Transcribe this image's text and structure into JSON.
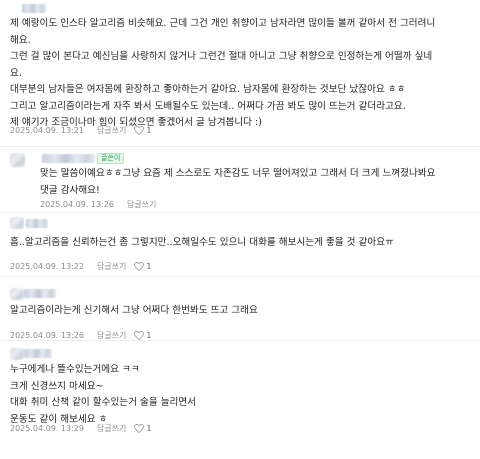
{
  "comments": [
    {
      "lines": [
        "제 예랑이도 인스타 알고리즘 비슷해요. 근데 그건 개인 취향이고 남자라면 많이들 볼꺼 같아서 전 그러려니",
        "해요.",
        "그런 걸 많이 본다고 예신님을 사랑하지 않거나 그런건 절대 아니고 그냥 취향으로 인정하는게 어떨까 싶네",
        "요.",
        "대부분의 남자들은 여자몸에 환장하고 좋아하는거 같아요. 남자몸에 환장하는 것보단 났잖아요 ㅎㅎ",
        "그리고 알고리즘이라는게 자주 봐서 도배될수도 있는데.. 어쩌다 가끔 봐도 많이 뜨는거 같더라고요.",
        "제 얘기가 조금이나마 힘이 되셨으면 좋겠어서 글 남겨봅니다 :)"
      ],
      "date": "2025.04.09. 13:21",
      "reply": "답글쓰기",
      "likes": "1"
    },
    {
      "badge": "글쓴이",
      "lines": [
        "맞는 말씀이예요ㅎㅎ그냥 요즘 제 스스로도 자존감도 너무 떨어져있고 그래서 더 크게 느껴졌나봐요",
        "댓글 감사해요!"
      ],
      "date": "2025.04.09. 13:26",
      "reply": "답글쓰기"
    },
    {
      "lines": [
        "흠..알고리즘을 신뢰하는건 좀 그렇지만..오해일수도 있으니 대화를 해보시는게 좋을 것 같아요ㅠ"
      ],
      "date": "2025.04.09. 13:22",
      "reply": "답글쓰기",
      "likes": "1"
    },
    {
      "lines": [
        "알고리즘이라는게 신기해서 그냥 어쩌다 한번봐도 뜨고 그래요"
      ],
      "date": "2025.04.09. 13:26",
      "reply": "답글쓰기",
      "likes": "1"
    },
    {
      "lines": [
        "누구에게나 뜰수있는거에요 ㅋㅋ",
        "크게 신경쓰지 마세요~",
        "대화 취미 산책 같이 할수있는거 술을 늘리면서",
        "운동도 같이 해보세요 ㅎ"
      ],
      "date": "2025.04.09. 13:29",
      "reply": "답글쓰기",
      "likes": "1"
    }
  ]
}
